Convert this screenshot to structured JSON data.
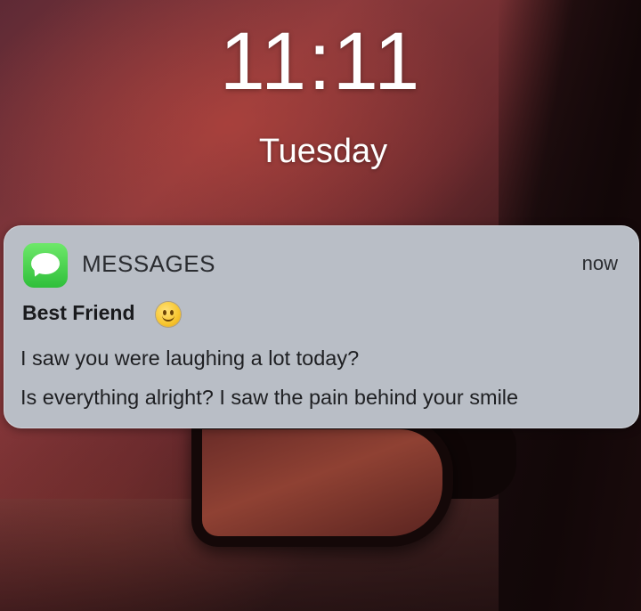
{
  "lockscreen": {
    "time": "11:11",
    "day": "Tuesday"
  },
  "notification": {
    "app_name": "MESSAGES",
    "app_icon": "messages-app-icon",
    "timestamp": "now",
    "sender": "Best Friend",
    "sender_emoji": "slightly-smiling-face-emoji",
    "message_lines": [
      "I saw you were laughing a lot today?",
      "Is everything alright? I saw the pain behind your smile"
    ],
    "colors": {
      "card_background": "#b9bec6",
      "app_icon_green": "#2fbf3a"
    }
  }
}
